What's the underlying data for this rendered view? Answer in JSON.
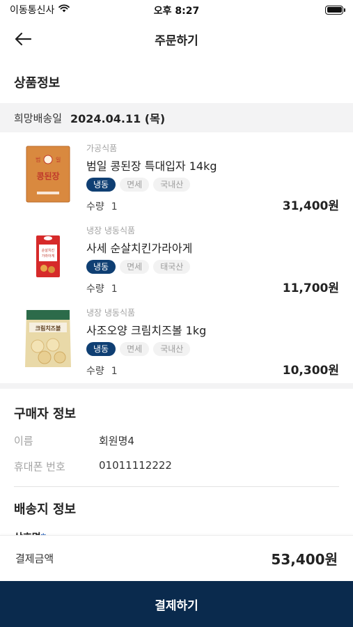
{
  "status": {
    "carrier": "이동통신사",
    "time": "오후 8:27"
  },
  "nav": {
    "title": "주문하기"
  },
  "products_section": {
    "title": "상품정보",
    "delivery_label": "희망배송일",
    "delivery_date": "2024.04.11 (목)",
    "items": [
      {
        "category": "가공식품",
        "name": "범일 콩된장 특대입자 14kg",
        "tags": [
          "냉동",
          "면세",
          "국내산"
        ],
        "qty_label": "수량",
        "qty": "1",
        "price": "31,400원",
        "image_icon": "soybean-paste-package-icon",
        "package_text": "콩된장"
      },
      {
        "category": "냉장 냉동식품",
        "name": "사세 순살치킨가라아게",
        "tags": [
          "냉동",
          "면세",
          "태국산"
        ],
        "qty_label": "수량",
        "qty": "1",
        "price": "11,700원",
        "image_icon": "chicken-karaage-package-icon",
        "package_text": "순살치킨가라아게"
      },
      {
        "category": "냉장 냉동식품",
        "name": "사조오양 크림치즈볼 1kg",
        "tags": [
          "냉동",
          "면세",
          "국내산"
        ],
        "qty_label": "수량",
        "qty": "1",
        "price": "10,300원",
        "image_icon": "cream-cheese-ball-package-icon",
        "package_text": "크림치즈볼"
      }
    ]
  },
  "buyer": {
    "title": "구매자 정보",
    "name_label": "이름",
    "name_value": "회원명4",
    "phone_label": "휴대폰 번호",
    "phone_value": "01011112222"
  },
  "shipping": {
    "title": "배송지 정보",
    "company_label": "상호명",
    "required_mark": "*"
  },
  "payment": {
    "label": "결제금액",
    "total": "53,400원",
    "button_label": "결제하기"
  },
  "colors": {
    "primary": "#0a2a4d",
    "tag_primary": "#0f3f73",
    "muted_band": "#f3f3f4"
  }
}
